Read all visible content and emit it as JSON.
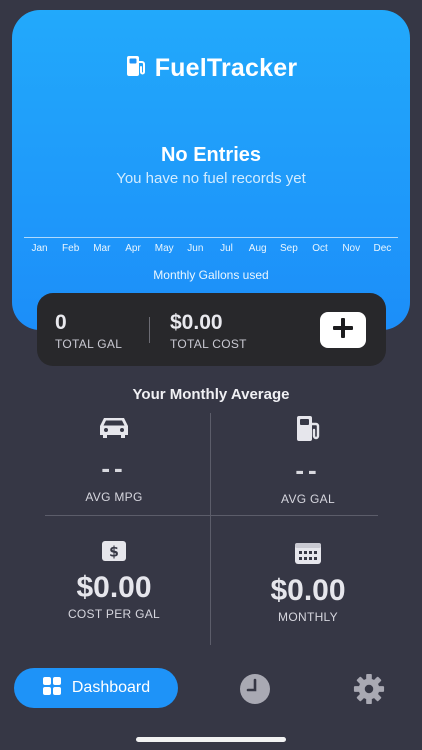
{
  "app": {
    "title_bold": "Fuel",
    "title_light": "Tracker"
  },
  "hero": {
    "empty_title": "No Entries",
    "empty_subtitle": "You have no fuel records yet",
    "months": [
      "Jan",
      "Feb",
      "Mar",
      "Apr",
      "May",
      "Jun",
      "Jul",
      "Aug",
      "Sep",
      "Oct",
      "Nov",
      "Dec"
    ],
    "chart_caption": "Monthly Gallons used"
  },
  "summary": {
    "total_gal_value": "0",
    "total_gal_label": "TOTAL GAL",
    "total_cost_value": "$0.00",
    "total_cost_label": "TOTAL COST"
  },
  "averages": {
    "title": "Your Monthly Average",
    "avg_mpg": {
      "value": "--",
      "label": "AVG MPG"
    },
    "avg_gal": {
      "value": "--",
      "label": "AVG GAL"
    },
    "cost_per_gal": {
      "value": "$0.00",
      "label": "COST PER GAL"
    },
    "monthly": {
      "value": "$0.00",
      "label": "MONTHLY"
    }
  },
  "tabs": {
    "dashboard_label": "Dashboard"
  },
  "colors": {
    "accent": "#1e93f8",
    "background": "#363745",
    "card": "#28282b"
  },
  "icons": [
    "fuel-pump-icon",
    "plus-icon",
    "car-icon",
    "dollar-icon",
    "calendar-icon",
    "grid-icon",
    "clock-icon",
    "gear-icon"
  ]
}
